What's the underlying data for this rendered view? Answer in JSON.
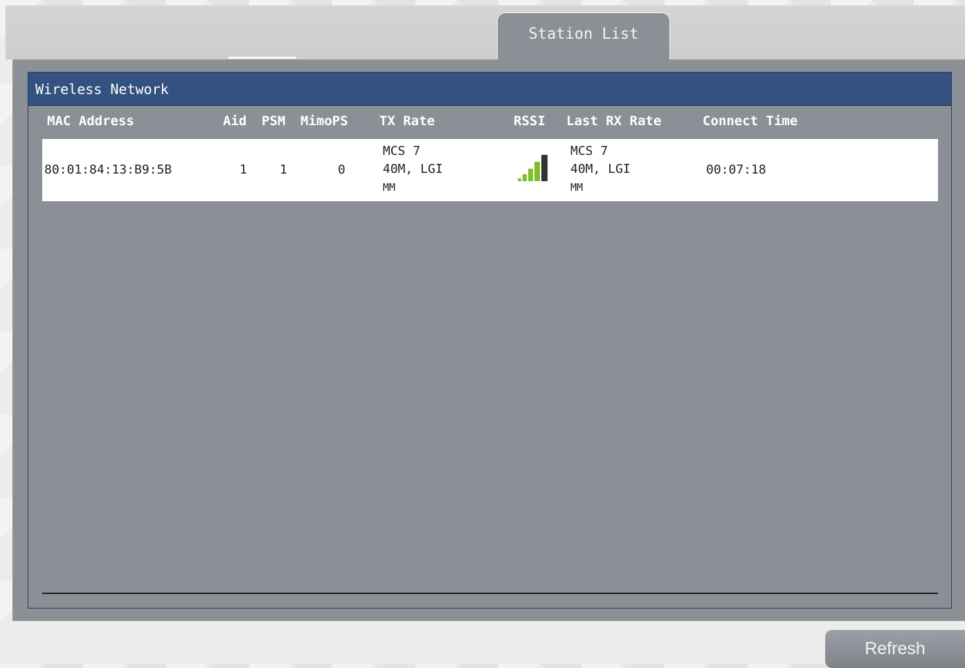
{
  "tab": {
    "label": "Station List"
  },
  "section": {
    "title": "Wireless Network"
  },
  "table": {
    "columns": [
      "MAC Address",
      "Aid",
      "PSM",
      "MimoPS",
      "TX Rate",
      "RSSI",
      "Last RX Rate",
      "Connect Time"
    ],
    "rows": [
      {
        "mac": "80:01:84:13:B9:5B",
        "aid": "1",
        "psm": "1",
        "mimops": "0",
        "tx_rate": [
          "MCS 7",
          "40M, LGI",
          "MM"
        ],
        "rssi_bars": 5,
        "rssi_colors": {
          "active": "#7fbf2a",
          "strongest": "#333333"
        },
        "last_rx_rate": [
          "MCS 7",
          "40M, LGI",
          "MM"
        ],
        "connect_time": "00:07:18"
      }
    ]
  },
  "buttons": {
    "refresh": "Refresh"
  }
}
